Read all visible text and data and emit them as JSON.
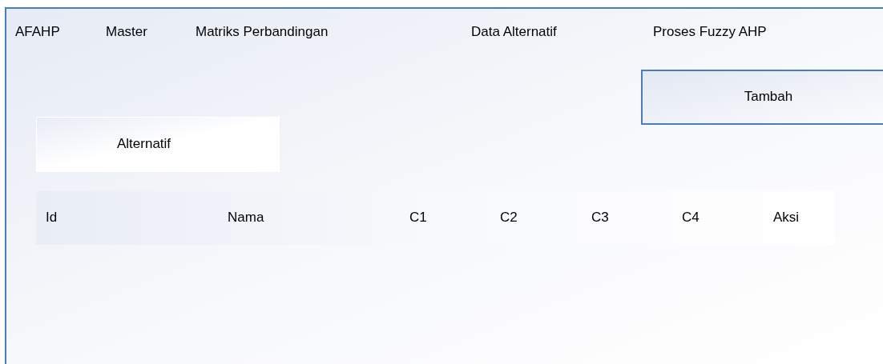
{
  "nav": [
    {
      "label": "AFAHP"
    },
    {
      "label": "Master"
    },
    {
      "label": "Matriks Perbandingan"
    },
    {
      "label": "Data Alternatif"
    },
    {
      "label": "Proses Fuzzy AHP"
    }
  ],
  "add_button": {
    "label": "Tambah"
  },
  "section_title": "Alternatif",
  "table": {
    "columns": [
      "Id",
      "Nama",
      "C1",
      "C2",
      "C3",
      "C4",
      "Aksi"
    ]
  }
}
